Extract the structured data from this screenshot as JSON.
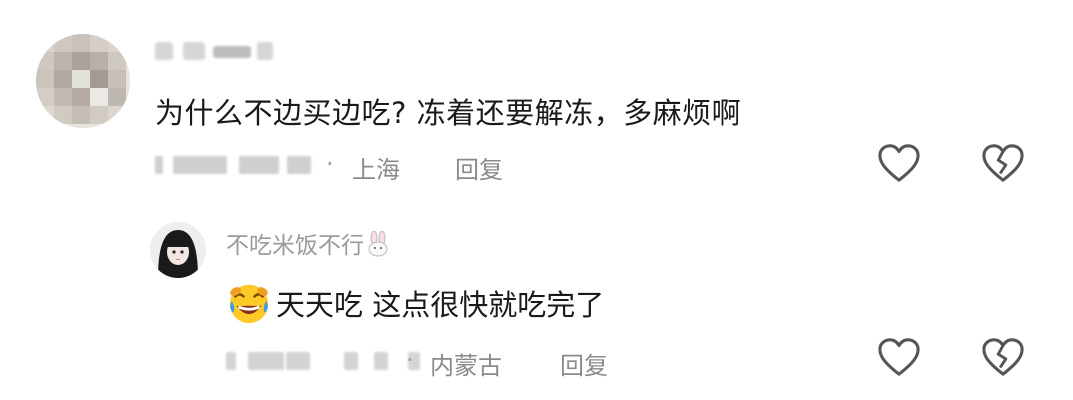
{
  "comment": {
    "text": "为什么不边买边吃? 冻着还要解冻，多麻烦啊",
    "location": "上海",
    "reply_label": "回复"
  },
  "reply": {
    "author": "不吃米饭不行",
    "text": "天天吃 这点很快就吃完了",
    "location": "内蒙古",
    "reply_label": "回复"
  },
  "icons": {
    "like": "heart-outline-icon",
    "dislike": "broken-heart-icon",
    "emoji": "rofl-emoji-icon",
    "bunny": "bunny-icon"
  },
  "colors": {
    "text": "#1a1a1a",
    "meta": "#8a8a8a",
    "icon_stroke": "#555555"
  }
}
